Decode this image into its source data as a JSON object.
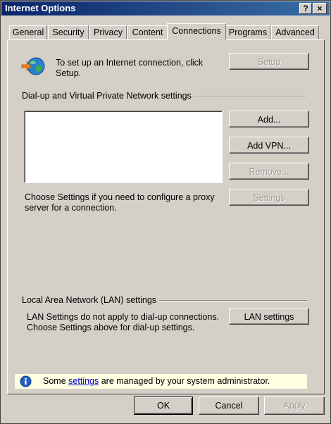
{
  "window": {
    "title": "Internet Options",
    "help_label": "?",
    "close_label": "×"
  },
  "tabs": [
    {
      "label": "General"
    },
    {
      "label": "Security"
    },
    {
      "label": "Privacy"
    },
    {
      "label": "Content"
    },
    {
      "label": "Connections"
    },
    {
      "label": "Programs"
    },
    {
      "label": "Advanced"
    }
  ],
  "setup": {
    "text": "To set up an Internet connection, click Setup.",
    "button": "Setup"
  },
  "dialup": {
    "heading": "Dial-up and Virtual Private Network settings",
    "add_button": "Add...",
    "add_vpn_button": "Add VPN...",
    "remove_button": "Remove...",
    "settings_text": "Choose Settings if you need to configure a proxy server for a connection.",
    "settings_button": "Settings"
  },
  "lan": {
    "heading": "Local Area Network (LAN) settings",
    "text": "LAN Settings do not apply to dial-up connections. Choose Settings above for dial-up settings.",
    "button": "LAN settings"
  },
  "info": {
    "prefix": "Some ",
    "link": "settings",
    "suffix": " are managed by your system administrator."
  },
  "footer": {
    "ok": "OK",
    "cancel": "Cancel",
    "apply": "Apply"
  }
}
